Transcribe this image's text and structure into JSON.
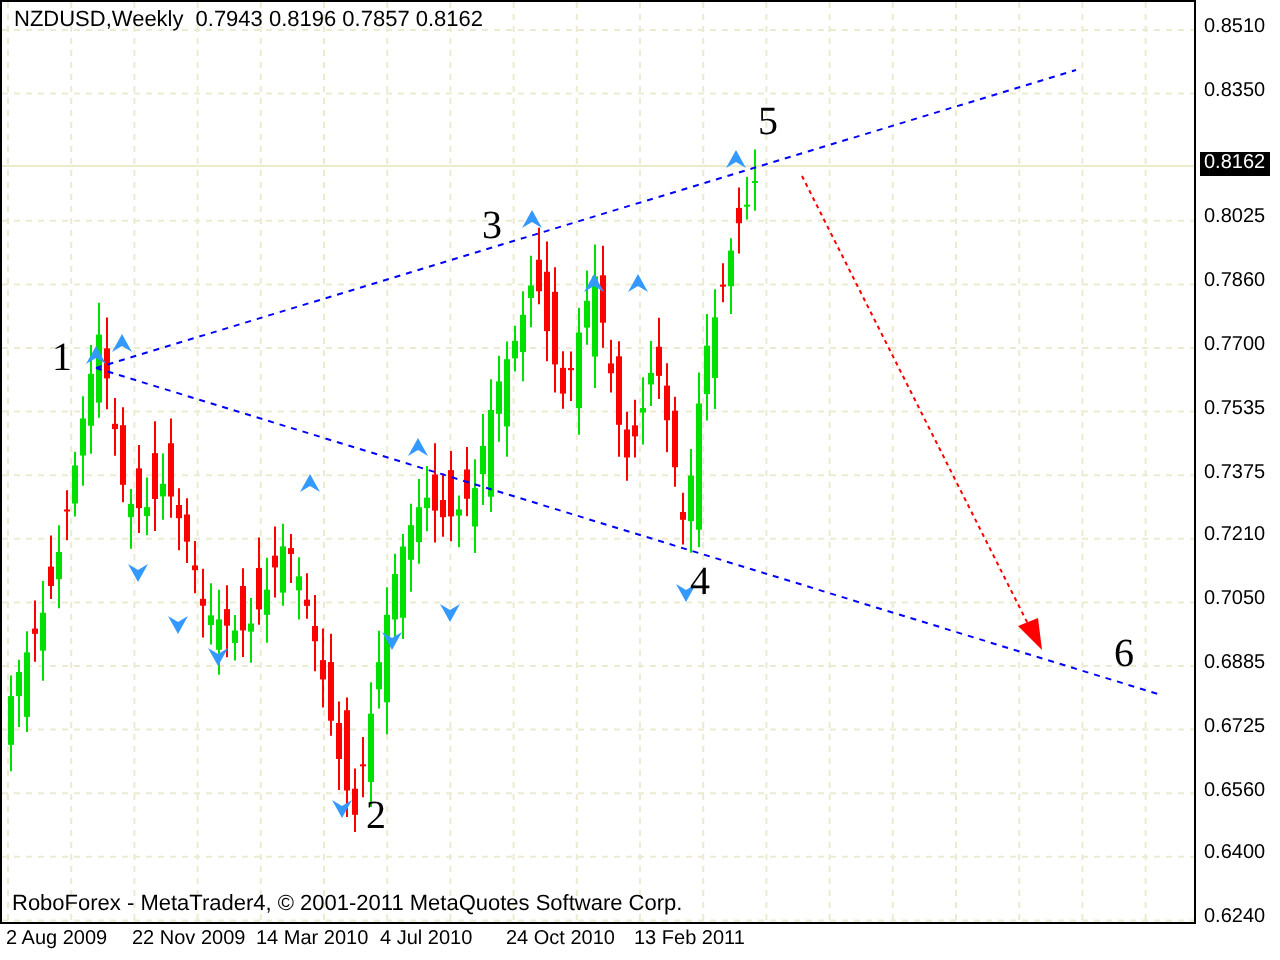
{
  "chart": {
    "symbol": "NZDUSD,Weekly",
    "quote": "0.7943 0.8196 0.7857 0.8162",
    "copyright": "RoboForex - MetaTrader4, © 2001-2011 MetaQuotes Software Corp.",
    "current_price": "0.8162",
    "price_ticks": [
      "0.8510",
      "0.8350",
      "0.8025",
      "0.7860",
      "0.7700",
      "0.7535",
      "0.7375",
      "0.7210",
      "0.7050",
      "0.6885",
      "0.6725",
      "0.6560",
      "0.6400",
      "0.6240"
    ],
    "date_ticks": [
      "2 Aug 2009",
      "22 Nov 2009",
      "14 Mar 2010",
      "4 Jul 2010",
      "24 Oct 2010",
      "13 Feb 2011"
    ],
    "wave_labels": [
      "1",
      "2",
      "3",
      "4",
      "5",
      "6"
    ]
  }
}
